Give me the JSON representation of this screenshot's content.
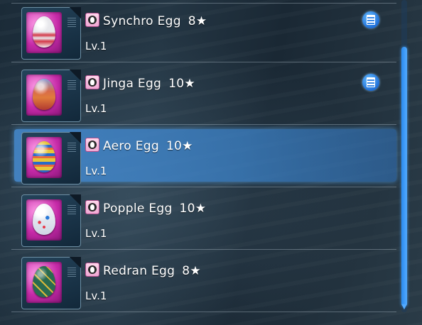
{
  "items": [
    {
      "name": "Synchro Egg",
      "stars": "8★",
      "level": "Lv.1",
      "has_memo": true,
      "selected": false,
      "egg_style": "synchro"
    },
    {
      "name": "Jinga Egg",
      "stars": "10★",
      "level": "Lv.1",
      "has_memo": true,
      "selected": false,
      "egg_style": "jinga"
    },
    {
      "name": "Aero Egg",
      "stars": "10★",
      "level": "Lv.1",
      "has_memo": false,
      "selected": true,
      "egg_style": "aero"
    },
    {
      "name": "Popple Egg",
      "stars": "10★",
      "level": "Lv.1",
      "has_memo": false,
      "selected": false,
      "egg_style": "popple"
    },
    {
      "name": "Redran Egg",
      "stars": "8★",
      "level": "Lv.1",
      "has_memo": false,
      "selected": false,
      "egg_style": "redran"
    }
  ],
  "colors": {
    "selection": "#4a8cd2",
    "thumb_bg": "#c62aa8",
    "scrollbar": "#2a8aee",
    "memo_icon": "#1f6fd8"
  },
  "icons": {
    "category": "egg-category-icon",
    "memo": "memo-icon",
    "scroll_down": "chevron-down-icon"
  }
}
